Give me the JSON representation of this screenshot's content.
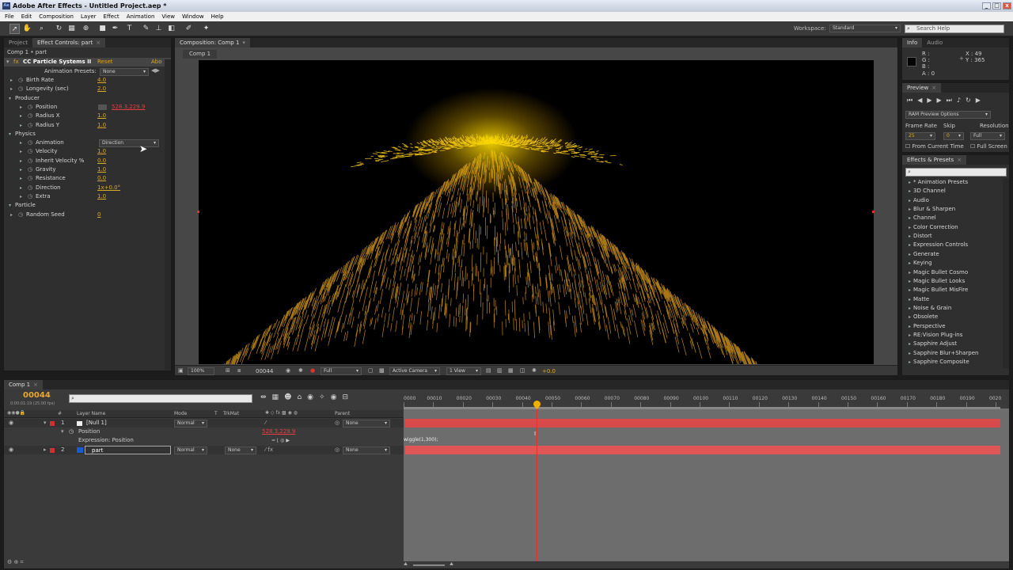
{
  "window": {
    "title": "Adobe After Effects - Untitled Project.aep *",
    "icon": "Ae"
  },
  "menu": [
    "File",
    "Edit",
    "Composition",
    "Layer",
    "Effect",
    "Animation",
    "View",
    "Window",
    "Help"
  ],
  "toolbar": {
    "workspace_label": "Workspace:",
    "workspace_value": "Standard",
    "search_help_placeholder": "Search Help"
  },
  "left_panel": {
    "tabs": [
      {
        "label": "Project"
      },
      {
        "label": "Effect Controls: part"
      }
    ],
    "breadcrumb": "Comp 1 • part",
    "effect": {
      "name": "CC Particle Systems II",
      "reset": "Reset",
      "about": "Abo"
    },
    "animation_presets": {
      "label": "Animation Presets:",
      "value": "None"
    },
    "properties": [
      {
        "label": "Birth Rate",
        "value": "4.0",
        "indent": 1
      },
      {
        "label": "Longevity (sec)",
        "value": "2.0",
        "indent": 0
      },
      {
        "label": "Producer",
        "value": "",
        "indent": 0,
        "group": true
      },
      {
        "label": "Position",
        "value": "528.3,229.9",
        "indent": 2,
        "red": true
      },
      {
        "label": "Radius X",
        "value": "1.0",
        "indent": 2
      },
      {
        "label": "Radius Y",
        "value": "1.0",
        "indent": 2
      },
      {
        "label": "Physics",
        "value": "",
        "indent": 0,
        "group": true
      },
      {
        "label": "Animation",
        "value": "Direction",
        "indent": 2,
        "dropdown": true
      },
      {
        "label": "Velocity",
        "value": "1.0",
        "indent": 2
      },
      {
        "label": "Inherit Velocity %",
        "value": "0.0",
        "indent": 2
      },
      {
        "label": "Gravity",
        "value": "1.0",
        "indent": 2
      },
      {
        "label": "Resistance",
        "value": "0.0",
        "indent": 2
      },
      {
        "label": "Direction",
        "value": "1x+0.0°",
        "indent": 2
      },
      {
        "label": "Extra",
        "value": "1.0",
        "indent": 2
      },
      {
        "label": "Particle",
        "value": "",
        "indent": 0,
        "group": true
      },
      {
        "label": "Random Seed",
        "value": "0",
        "indent": 0
      }
    ]
  },
  "comp_panel": {
    "tab": "Composition: Comp 1",
    "subtab": "Comp 1",
    "footer": {
      "zoom": "100%",
      "timecode": "00044",
      "resolution": "Full",
      "camera": "Active Camera",
      "views": "1 View",
      "exposure": "+0.0"
    }
  },
  "info_panel": {
    "tabs": [
      "Info",
      "Audio"
    ],
    "r": "R :",
    "g": "G :",
    "b": "B :",
    "a": "A : 0",
    "x": "X : 49",
    "y": "Y : 365"
  },
  "preview_panel": {
    "tab": "Preview",
    "ram_options": "RAM Preview Options",
    "frame_rate_label": "Frame Rate",
    "skip_label": "Skip",
    "resolution_label": "Resolution",
    "frame_rate": "25",
    "skip": "0",
    "resolution": "Full",
    "from_current_time": "From Current Time",
    "full_screen": "Full Screen"
  },
  "effects_panel": {
    "tab": "Effects & Presets",
    "items": [
      "* Animation Presets",
      "3D Channel",
      "Audio",
      "Blur & Sharpen",
      "Channel",
      "Color Correction",
      "Distort",
      "Expression Controls",
      "Generate",
      "Keying",
      "Magic Bullet Cosmo",
      "Magic Bullet Looks",
      "Magic Bullet MisFire",
      "Matte",
      "Noise & Grain",
      "Obsolete",
      "Perspective",
      "RE:Vision Plug-ins",
      "Sapphire Adjust",
      "Sapphire Blur+Sharpen",
      "Sapphire Composite"
    ]
  },
  "timeline": {
    "tab": "Comp 1",
    "timecode": "00044",
    "timecode_sub": "0:00:01:19 (25.00 fps)",
    "columns": {
      "layer_name": "Layer Name",
      "mode": "Mode",
      "t": "T",
      "trkmat": "TrkMat",
      "parent": "Parent"
    },
    "layers": [
      {
        "num": "1",
        "name": "[Null 1]",
        "mode": "Normal",
        "trkmat": "",
        "parent": "None",
        "color": "#d03030"
      },
      {
        "num": "2",
        "name": "part",
        "mode": "Normal",
        "trkmat": "None",
        "parent": "None",
        "color": "#1a5ad0"
      }
    ],
    "position_label": "Position",
    "position_value": "528.3,229.9",
    "expression_label": "Expression: Position",
    "expression_text": "wiggle(1,300);",
    "ruler": [
      "0000",
      "00010",
      "00020",
      "00030",
      "00040",
      "00050",
      "00060",
      "00070",
      "00080",
      "00090",
      "00100",
      "00110",
      "00120",
      "00130",
      "00140",
      "00150",
      "00160",
      "00170",
      "00180",
      "00190",
      "0020"
    ]
  },
  "colors": {
    "accent": "#d9a829",
    "layer_bar_red": "#d84a4a",
    "particle": "#f2c233"
  }
}
